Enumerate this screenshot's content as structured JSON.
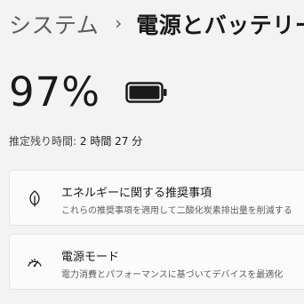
{
  "breadcrumb": {
    "parent": "システム",
    "separator": "›",
    "current": "電源とバッテリー"
  },
  "battery": {
    "percent_text": "97%",
    "level": 0.97,
    "remaining_label": "推定残り時間:",
    "remaining_value": "2 時間 27 分"
  },
  "cards": [
    {
      "icon": "leaf-icon",
      "title": "エネルギーに関する推奨事項",
      "subtitle": "これらの推奨事項を適用して二酸化炭素排出量を削減する"
    },
    {
      "icon": "power-mode-gauge-icon",
      "title": "電源モード",
      "subtitle": "電力消費とパフォーマンスに基づいてデバイスを最適化"
    }
  ]
}
